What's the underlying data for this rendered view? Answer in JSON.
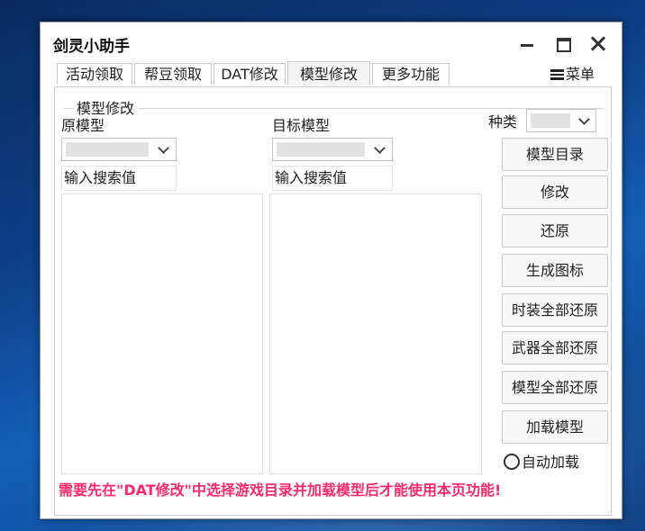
{
  "window": {
    "title": "剑灵小助手"
  },
  "tabs": [
    {
      "label": "活动领取"
    },
    {
      "label": "帮豆领取"
    },
    {
      "label": "DAT修改"
    },
    {
      "label": "模型修改"
    },
    {
      "label": "更多功能"
    }
  ],
  "active_tab": "模型修改",
  "menu": {
    "label": "菜单",
    "icon": "hamburger-icon"
  },
  "group": {
    "title": "模型修改"
  },
  "source": {
    "label": "原模型",
    "search_value": "输入搜索值"
  },
  "target": {
    "label": "目标模型",
    "search_value": "输入搜索值"
  },
  "category": {
    "label": "种类"
  },
  "buttons": {
    "model_dir": "模型目录",
    "modify": "修改",
    "restore": "还原",
    "gen_icon": "生成图标",
    "restore_costume": "时装全部还原",
    "restore_weapon": "武器全部还原",
    "restore_model": "模型全部还原",
    "load_model": "加载模型"
  },
  "auto_load": {
    "label": "自动加载",
    "checked": false
  },
  "notice": "需要先在\"DAT修改\"中选择游戏目录并加载模型后才能使用本页功能!",
  "colors": {
    "notice": "#ff2a6a",
    "desktop": "#0d3f86"
  }
}
